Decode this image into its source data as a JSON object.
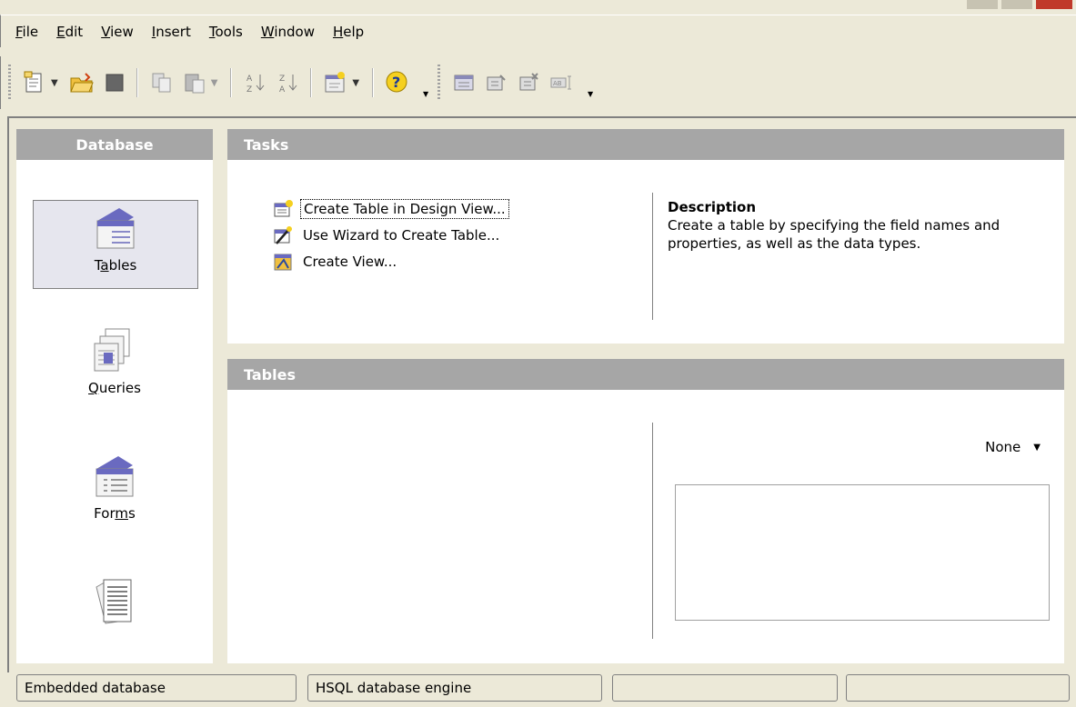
{
  "menu": {
    "items": [
      {
        "pre": "",
        "key": "F",
        "post": "ile"
      },
      {
        "pre": "",
        "key": "E",
        "post": "dit"
      },
      {
        "pre": "",
        "key": "V",
        "post": "iew"
      },
      {
        "pre": "",
        "key": "I",
        "post": "nsert"
      },
      {
        "pre": "",
        "key": "T",
        "post": "ools"
      },
      {
        "pre": "",
        "key": "W",
        "post": "indow"
      },
      {
        "pre": "",
        "key": "H",
        "post": "elp"
      }
    ]
  },
  "toolbar": {
    "icons": [
      "new-document-icon",
      "open-folder-icon",
      "save-icon",
      "copy-icon",
      "paste-icon",
      "sort-ascending-icon",
      "sort-descending-icon",
      "form-design-icon",
      "help-icon",
      "table-data-icon",
      "edit-icon",
      "edit-delete-icon",
      "rename-icon"
    ]
  },
  "database_panel": {
    "title": "Database",
    "items": [
      {
        "pre": "T",
        "key": "a",
        "post": "bles",
        "selected": true
      },
      {
        "pre": "",
        "key": "Q",
        "post": "ueries",
        "selected": false
      },
      {
        "pre": "For",
        "key": "m",
        "post": "s",
        "selected": false
      },
      {
        "pre": "",
        "key": "",
        "post": "",
        "selected": false
      }
    ]
  },
  "tasks_panel": {
    "title": "Tasks",
    "tasks": [
      {
        "label": "Create Table in Design View...",
        "icon": "table-design-icon",
        "focused": true
      },
      {
        "label": "Use Wizard to Create Table...",
        "icon": "wizard-icon",
        "focused": false
      },
      {
        "label": "Create View...",
        "icon": "view-icon",
        "focused": false
      }
    ],
    "description_title": "Description",
    "description_text": "Create a table by specifying the field names and properties, as well as the data types."
  },
  "tables_panel": {
    "title": "Tables",
    "preview_mode": "None"
  },
  "statusbar": {
    "cells": [
      "Embedded database",
      "HSQL database engine",
      "",
      ""
    ]
  }
}
